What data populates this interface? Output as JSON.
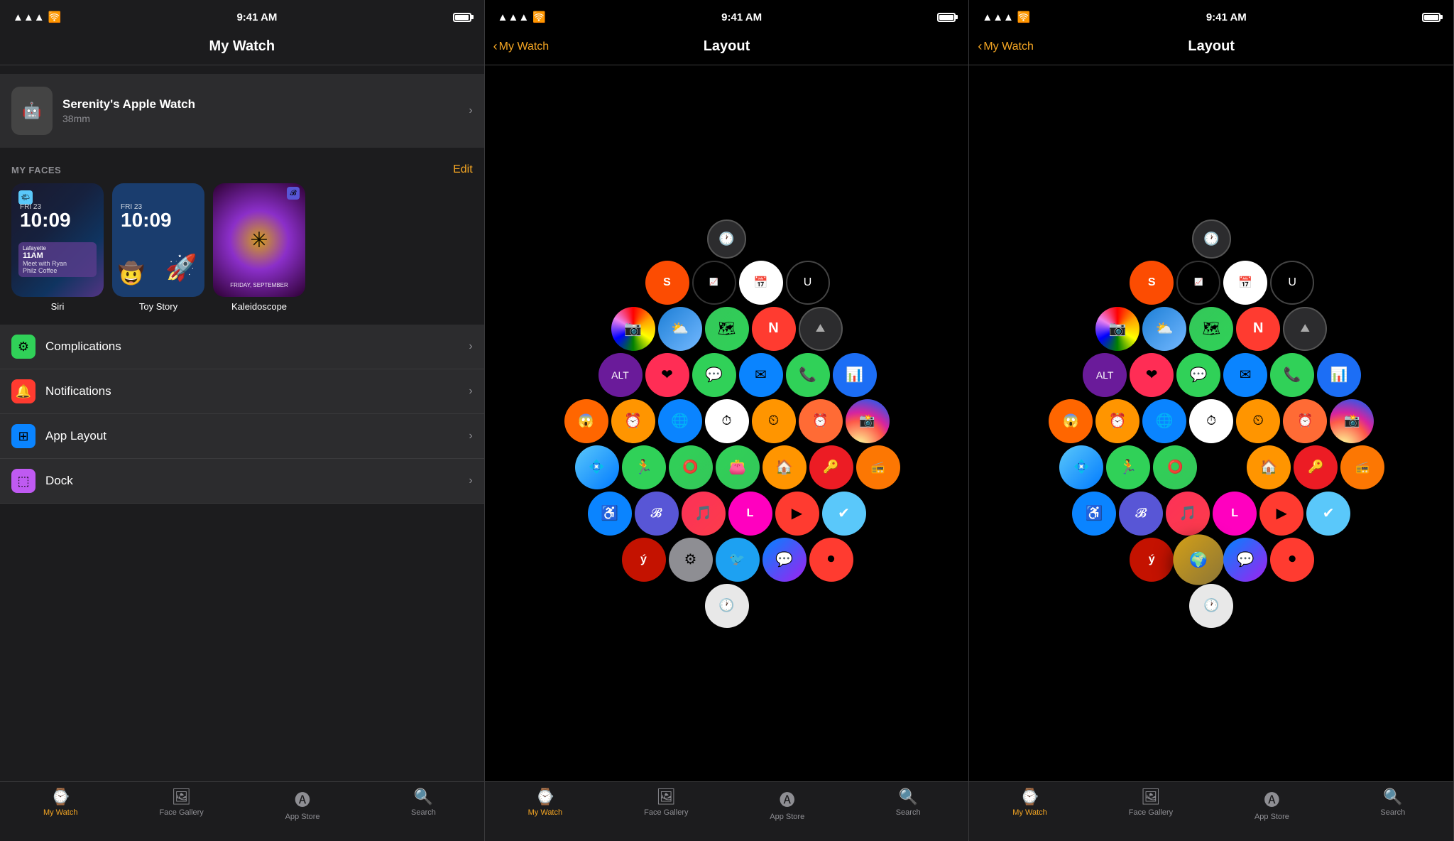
{
  "statusBar": {
    "time": "9:41 AM",
    "signal": "●●●",
    "wifi": "wifi",
    "battery": "full"
  },
  "panel1": {
    "title": "My Watch",
    "watchName": "Serenity's Apple Watch",
    "watchSize": "38mm",
    "myFacesLabel": "MY FACES",
    "editLabel": "Edit",
    "faces": [
      {
        "name": "Siri",
        "type": "siri"
      },
      {
        "name": "Toy Story",
        "type": "toystory"
      },
      {
        "name": "Kaleidoscope",
        "type": "kaleido"
      }
    ],
    "menuItems": [
      {
        "label": "Complications",
        "iconType": "green",
        "icon": "⚙"
      },
      {
        "label": "Notifications",
        "iconType": "red",
        "icon": "🔔"
      },
      {
        "label": "App Layout",
        "iconType": "blue",
        "icon": "⊞"
      },
      {
        "label": "Dock",
        "iconType": "purple",
        "icon": "⬚"
      }
    ],
    "tabBar": {
      "items": [
        {
          "label": "My Watch",
          "active": true
        },
        {
          "label": "Face Gallery",
          "active": false
        },
        {
          "label": "App Store",
          "active": false
        },
        {
          "label": "Search",
          "active": false
        }
      ]
    }
  },
  "panel2": {
    "backLabel": "My Watch",
    "title": "Layout",
    "tabBar": {
      "items": [
        {
          "label": "My Watch",
          "active": true
        },
        {
          "label": "Face Gallery",
          "active": false
        },
        {
          "label": "App Store",
          "active": false
        },
        {
          "label": "Search",
          "active": false
        }
      ]
    }
  },
  "panel3": {
    "backLabel": "My Watch",
    "title": "Layout",
    "tabBar": {
      "items": [
        {
          "label": "My Watch",
          "active": true
        },
        {
          "label": "Face Gallery",
          "active": false
        },
        {
          "label": "App Store",
          "active": false
        },
        {
          "label": "Search",
          "active": false
        }
      ]
    }
  },
  "colors": {
    "accent": "#f5a623",
    "background": "#1c1c1e",
    "darkBackground": "#000000",
    "separator": "#3a3a3c"
  }
}
